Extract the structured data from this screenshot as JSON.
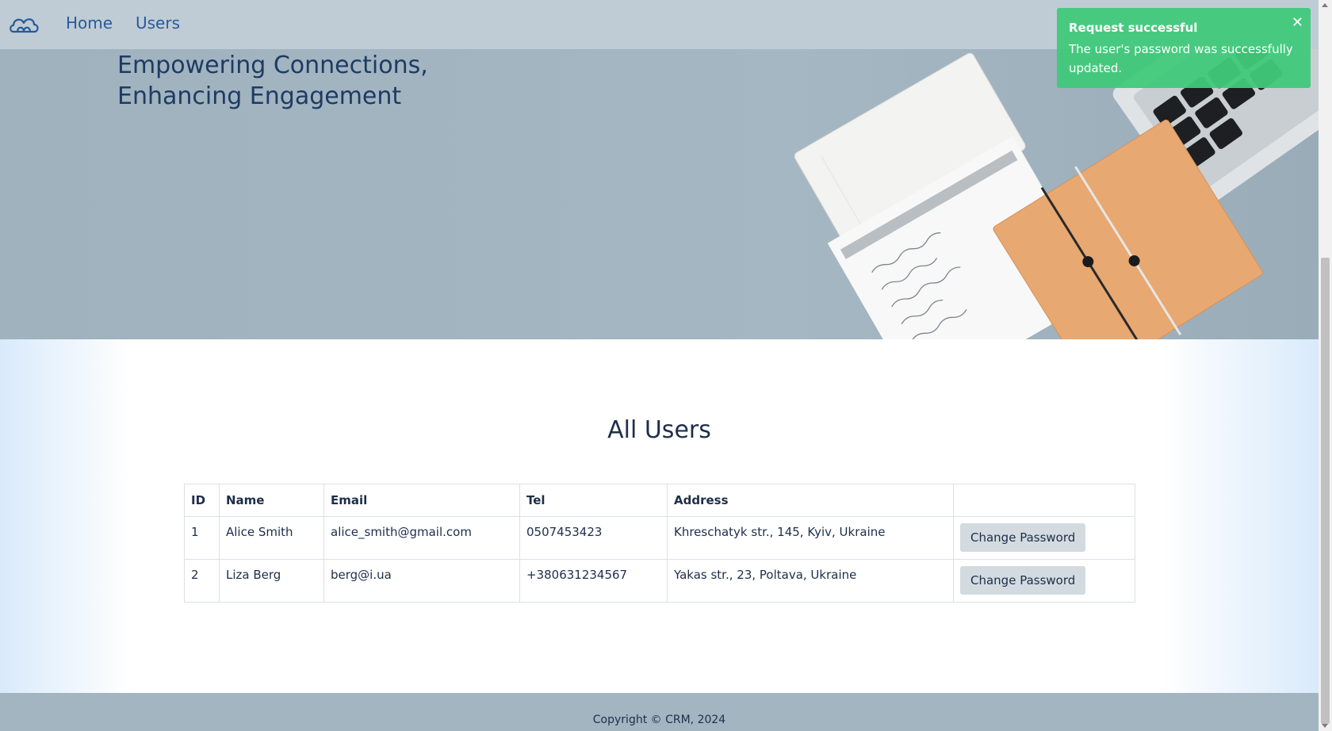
{
  "nav": {
    "links": [
      {
        "label": "Home"
      },
      {
        "label": "Users"
      }
    ]
  },
  "hero": {
    "title_line1": "Empowering Connections,",
    "title_line2": "Enhancing Engagement"
  },
  "users_section": {
    "title": "All Users",
    "columns": [
      "ID",
      "Name",
      "Email",
      "Tel",
      "Address",
      ""
    ],
    "rows": [
      {
        "id": "1",
        "name": "Alice Smith",
        "email": "alice_smith@gmail.com",
        "tel": "0507453423",
        "address": "Khreschatyk str., 145, Kyiv, Ukraine",
        "action": "Change Password"
      },
      {
        "id": "2",
        "name": "Liza Berg",
        "email": "berg@i.ua",
        "tel": "+380631234567",
        "address": "Yakas str., 23, Poltava, Ukraine",
        "action": "Change Password"
      }
    ]
  },
  "footer": {
    "text": "Copyright © CRM, 2024"
  },
  "toast": {
    "title": "Request successful",
    "message": "The user's password was successfully updated.",
    "close_icon": "close-icon",
    "color": "#40c97a"
  },
  "colors": {
    "navbar": "#bfccd5",
    "hero": "#a3b5c1",
    "text_dark": "#1e2e4a",
    "button": "#d3dbe1"
  }
}
